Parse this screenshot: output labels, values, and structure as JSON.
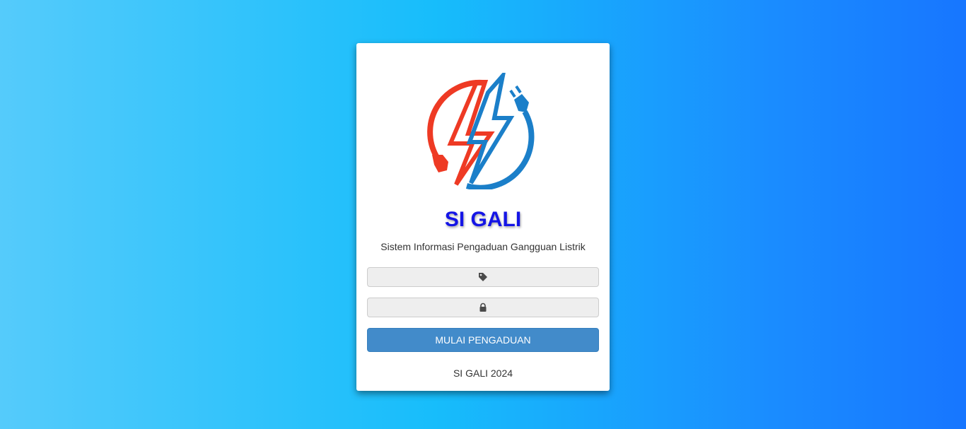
{
  "app": {
    "title": "SI GALI",
    "subtitle": "Sistem Informasi Pengaduan Gangguan Listrik",
    "footer": "SI GALI 2024"
  },
  "form": {
    "username": {
      "value": "",
      "placeholder": "",
      "icon": "tag-icon"
    },
    "password": {
      "value": "",
      "placeholder": "",
      "icon": "lock-icon"
    },
    "submit_label": "MULAI PENGADUAN"
  },
  "colors": {
    "background_start": "#55cbfb",
    "background_end": "#1776ff",
    "title": "#1515e6",
    "button": "#428bca",
    "logo_red": "#ee3a24",
    "logo_blue": "#1b7fc9"
  }
}
